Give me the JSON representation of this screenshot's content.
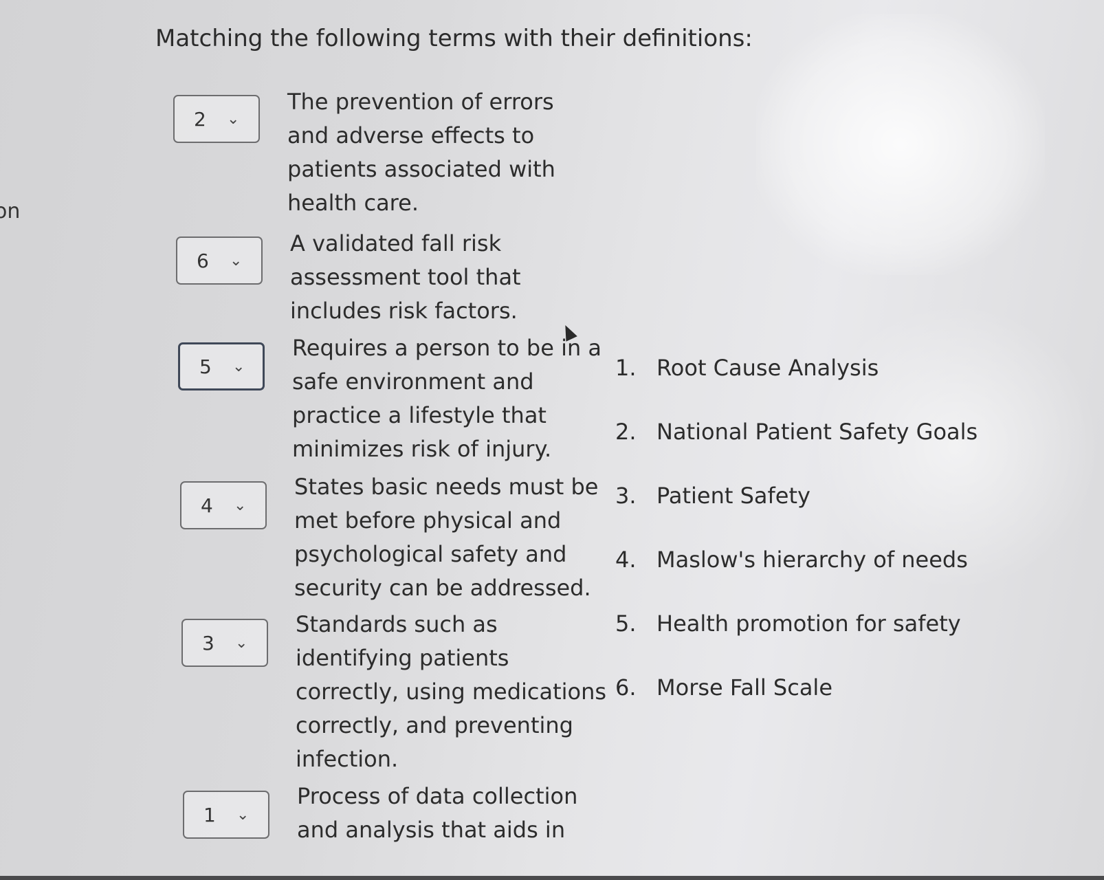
{
  "side_fragment": "on",
  "title": "Matching the following terms with their definitions:",
  "rows": [
    {
      "selected": "2",
      "definition": "The prevention of errors\nand adverse effects to\npatients associated with\nhealth care."
    },
    {
      "selected": "6",
      "definition": "A validated fall risk\nassessment tool that\nincludes risk factors."
    },
    {
      "selected": "5",
      "definition": "Requires a person to be in a\nsafe environment and\npractice a lifestyle that\nminimizes risk of injury."
    },
    {
      "selected": "4",
      "definition": "States basic needs must be\nmet before physical and\npsychological safety and\nsecurity can be addressed."
    },
    {
      "selected": "3",
      "definition": "Standards such as\nidentifying patients\ncorrectly, using medications\ncorrectly, and preventing\ninfection."
    },
    {
      "selected": "1",
      "definition": "Process of data collection\nand analysis that aids in"
    }
  ],
  "options": [
    {
      "num": "1.",
      "label": "Root Cause Analysis"
    },
    {
      "num": "2.",
      "label": "National Patient Safety Goals"
    },
    {
      "num": "3.",
      "label": "Patient Safety"
    },
    {
      "num": "4.",
      "label": "Maslow's hierarchy of needs"
    },
    {
      "num": "5.",
      "label": "Health promotion for safety"
    },
    {
      "num": "6.",
      "label": "Morse Fall Scale"
    }
  ],
  "chevron_icon": "chevron-down-icon",
  "cursor_icon": "mouse-pointer-icon"
}
